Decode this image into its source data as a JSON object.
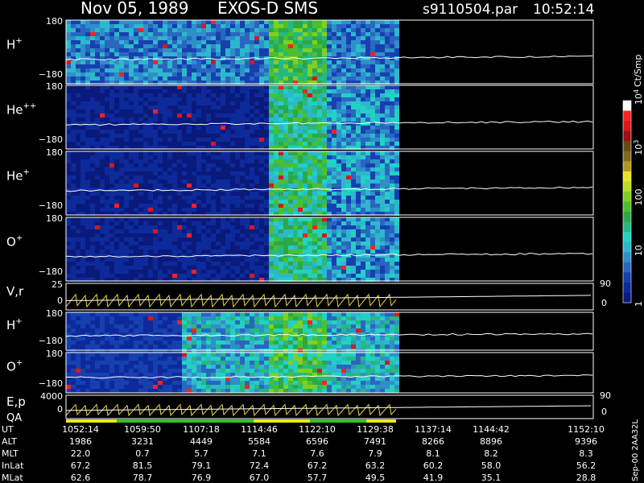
{
  "header": {
    "date": "Nov 05, 1989",
    "instrument": "EXOS-D SMS",
    "file": "s9110504.par",
    "time": "10:52:14"
  },
  "colorbar": {
    "unit": "Ct/Smp",
    "ticks": [
      {
        "label": "1",
        "value": 1
      },
      {
        "label": "10",
        "value": 10
      },
      {
        "label": "100",
        "value": 100
      },
      {
        "base": "10",
        "exp": "3",
        "value": 1000
      },
      {
        "base": "10",
        "exp": "4",
        "value": 10000
      }
    ],
    "colors": [
      "#0a1a7a",
      "#0d2a9a",
      "#1640b0",
      "#2a66c0",
      "#2f8fc8",
      "#2cb8cc",
      "#22d0c4",
      "#26b880",
      "#2ca848",
      "#4cc02c",
      "#80d020",
      "#b8e020",
      "#e8e820",
      "#b09820",
      "#806a1c",
      "#6a4a14",
      "#a01010",
      "#d81818",
      "#ff2020",
      "#ffffff"
    ]
  },
  "panels": [
    {
      "label_base": "H",
      "label_sup": "+",
      "ytop": "180",
      "ybot": "−180",
      "kind": "spec"
    },
    {
      "label_base": "He",
      "label_sup": "++",
      "ytop": "180",
      "ybot": "−180",
      "kind": "spec"
    },
    {
      "label_base": "He",
      "label_sup": "+",
      "ytop": "180",
      "ybot": "−180",
      "kind": "spec"
    },
    {
      "label_base": "O",
      "label_sup": "+",
      "ytop": "180",
      "ybot": "−180",
      "kind": "spec"
    },
    {
      "label_base": "V,r",
      "label_sup": "",
      "ytop": "25",
      "ybot": "0",
      "right_top": "90",
      "right_bot": "0",
      "kind": "line"
    },
    {
      "label_base": "H",
      "label_sup": "+",
      "ytop": "180",
      "ybot": "−180",
      "kind": "spec"
    },
    {
      "label_base": "O",
      "label_sup": "+",
      "ytop": "180",
      "ybot": "−180",
      "kind": "spec"
    },
    {
      "label_base": "E,p",
      "label_sup": "",
      "label2": "QA",
      "ytop": "4000",
      "ybot": "0",
      "right_top": "90",
      "right_bot": "0",
      "kind": "line"
    }
  ],
  "table": {
    "rows": [
      {
        "label": "UT",
        "values": [
          "1052:14",
          "1059:50",
          "1107:18",
          "1114:46",
          "1122:10",
          "1129:38",
          "1137:14",
          "1144:42",
          "1152:10"
        ]
      },
      {
        "label": "ALT",
        "values": [
          "1986",
          "3231",
          "4449",
          "5584",
          "6596",
          "7491",
          "8266",
          "8896",
          "9396"
        ]
      },
      {
        "label": "MLT",
        "values": [
          "22.0",
          "0.7",
          "5.7",
          "7.1",
          "7.6",
          "7.9",
          "8.1",
          "8.2",
          "8.3"
        ]
      },
      {
        "label": "InLat",
        "values": [
          "67.2",
          "81.5",
          "79.1",
          "72.4",
          "67.2",
          "63.2",
          "60.2",
          "58.0",
          "56.2"
        ]
      },
      {
        "label": "MLat",
        "values": [
          "62.6",
          "78.7",
          "76.9",
          "67.0",
          "57.7",
          "49.5",
          "41.9",
          "35.1",
          "28.8"
        ]
      }
    ]
  },
  "side_note": "Sep-00 2AA32L",
  "chart_data": {
    "type": "heatmap",
    "title": "Nov 05, 1989 EXOS-D SMS",
    "x_ticks": [
      "1052:14",
      "1059:50",
      "1107:18",
      "1114:46",
      "1122:10",
      "1129:38",
      "1137:14",
      "1144:42",
      "1152:10"
    ],
    "data_end_fraction": 0.5,
    "series": [
      {
        "name": "H+",
        "ylim": [
          -180,
          180
        ]
      },
      {
        "name": "He++",
        "ylim": [
          -180,
          180
        ]
      },
      {
        "name": "He+",
        "ylim": [
          -180,
          180
        ]
      },
      {
        "name": "O+",
        "ylim": [
          -180,
          180
        ]
      },
      {
        "name": "V,r",
        "ylim": [
          0,
          25
        ]
      },
      {
        "name": "H+",
        "ylim": [
          -180,
          180
        ]
      },
      {
        "name": "O+",
        "ylim": [
          -180,
          180
        ]
      },
      {
        "name": "E,p",
        "ylim": [
          0,
          4000
        ]
      }
    ],
    "colorbar_range": [
      1,
      10000
    ],
    "colorbar_scale": "log"
  }
}
